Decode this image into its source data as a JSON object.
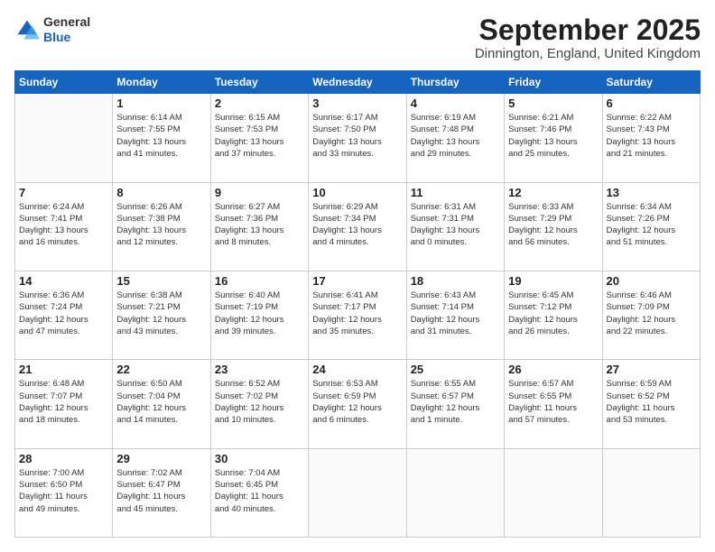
{
  "header": {
    "logo_general": "General",
    "logo_blue": "Blue",
    "month_title": "September 2025",
    "location": "Dinnington, England, United Kingdom"
  },
  "days_of_week": [
    "Sunday",
    "Monday",
    "Tuesday",
    "Wednesday",
    "Thursday",
    "Friday",
    "Saturday"
  ],
  "weeks": [
    [
      {
        "day": "",
        "info": ""
      },
      {
        "day": "1",
        "info": "Sunrise: 6:14 AM\nSunset: 7:55 PM\nDaylight: 13 hours\nand 41 minutes."
      },
      {
        "day": "2",
        "info": "Sunrise: 6:15 AM\nSunset: 7:53 PM\nDaylight: 13 hours\nand 37 minutes."
      },
      {
        "day": "3",
        "info": "Sunrise: 6:17 AM\nSunset: 7:50 PM\nDaylight: 13 hours\nand 33 minutes."
      },
      {
        "day": "4",
        "info": "Sunrise: 6:19 AM\nSunset: 7:48 PM\nDaylight: 13 hours\nand 29 minutes."
      },
      {
        "day": "5",
        "info": "Sunrise: 6:21 AM\nSunset: 7:46 PM\nDaylight: 13 hours\nand 25 minutes."
      },
      {
        "day": "6",
        "info": "Sunrise: 6:22 AM\nSunset: 7:43 PM\nDaylight: 13 hours\nand 21 minutes."
      }
    ],
    [
      {
        "day": "7",
        "info": "Sunrise: 6:24 AM\nSunset: 7:41 PM\nDaylight: 13 hours\nand 16 minutes."
      },
      {
        "day": "8",
        "info": "Sunrise: 6:26 AM\nSunset: 7:38 PM\nDaylight: 13 hours\nand 12 minutes."
      },
      {
        "day": "9",
        "info": "Sunrise: 6:27 AM\nSunset: 7:36 PM\nDaylight: 13 hours\nand 8 minutes."
      },
      {
        "day": "10",
        "info": "Sunrise: 6:29 AM\nSunset: 7:34 PM\nDaylight: 13 hours\nand 4 minutes."
      },
      {
        "day": "11",
        "info": "Sunrise: 6:31 AM\nSunset: 7:31 PM\nDaylight: 13 hours\nand 0 minutes."
      },
      {
        "day": "12",
        "info": "Sunrise: 6:33 AM\nSunset: 7:29 PM\nDaylight: 12 hours\nand 56 minutes."
      },
      {
        "day": "13",
        "info": "Sunrise: 6:34 AM\nSunset: 7:26 PM\nDaylight: 12 hours\nand 51 minutes."
      }
    ],
    [
      {
        "day": "14",
        "info": "Sunrise: 6:36 AM\nSunset: 7:24 PM\nDaylight: 12 hours\nand 47 minutes."
      },
      {
        "day": "15",
        "info": "Sunrise: 6:38 AM\nSunset: 7:21 PM\nDaylight: 12 hours\nand 43 minutes."
      },
      {
        "day": "16",
        "info": "Sunrise: 6:40 AM\nSunset: 7:19 PM\nDaylight: 12 hours\nand 39 minutes."
      },
      {
        "day": "17",
        "info": "Sunrise: 6:41 AM\nSunset: 7:17 PM\nDaylight: 12 hours\nand 35 minutes."
      },
      {
        "day": "18",
        "info": "Sunrise: 6:43 AM\nSunset: 7:14 PM\nDaylight: 12 hours\nand 31 minutes."
      },
      {
        "day": "19",
        "info": "Sunrise: 6:45 AM\nSunset: 7:12 PM\nDaylight: 12 hours\nand 26 minutes."
      },
      {
        "day": "20",
        "info": "Sunrise: 6:46 AM\nSunset: 7:09 PM\nDaylight: 12 hours\nand 22 minutes."
      }
    ],
    [
      {
        "day": "21",
        "info": "Sunrise: 6:48 AM\nSunset: 7:07 PM\nDaylight: 12 hours\nand 18 minutes."
      },
      {
        "day": "22",
        "info": "Sunrise: 6:50 AM\nSunset: 7:04 PM\nDaylight: 12 hours\nand 14 minutes."
      },
      {
        "day": "23",
        "info": "Sunrise: 6:52 AM\nSunset: 7:02 PM\nDaylight: 12 hours\nand 10 minutes."
      },
      {
        "day": "24",
        "info": "Sunrise: 6:53 AM\nSunset: 6:59 PM\nDaylight: 12 hours\nand 6 minutes."
      },
      {
        "day": "25",
        "info": "Sunrise: 6:55 AM\nSunset: 6:57 PM\nDaylight: 12 hours\nand 1 minute."
      },
      {
        "day": "26",
        "info": "Sunrise: 6:57 AM\nSunset: 6:55 PM\nDaylight: 11 hours\nand 57 minutes."
      },
      {
        "day": "27",
        "info": "Sunrise: 6:59 AM\nSunset: 6:52 PM\nDaylight: 11 hours\nand 53 minutes."
      }
    ],
    [
      {
        "day": "28",
        "info": "Sunrise: 7:00 AM\nSunset: 6:50 PM\nDaylight: 11 hours\nand 49 minutes."
      },
      {
        "day": "29",
        "info": "Sunrise: 7:02 AM\nSunset: 6:47 PM\nDaylight: 11 hours\nand 45 minutes."
      },
      {
        "day": "30",
        "info": "Sunrise: 7:04 AM\nSunset: 6:45 PM\nDaylight: 11 hours\nand 40 minutes."
      },
      {
        "day": "",
        "info": ""
      },
      {
        "day": "",
        "info": ""
      },
      {
        "day": "",
        "info": ""
      },
      {
        "day": "",
        "info": ""
      }
    ]
  ]
}
